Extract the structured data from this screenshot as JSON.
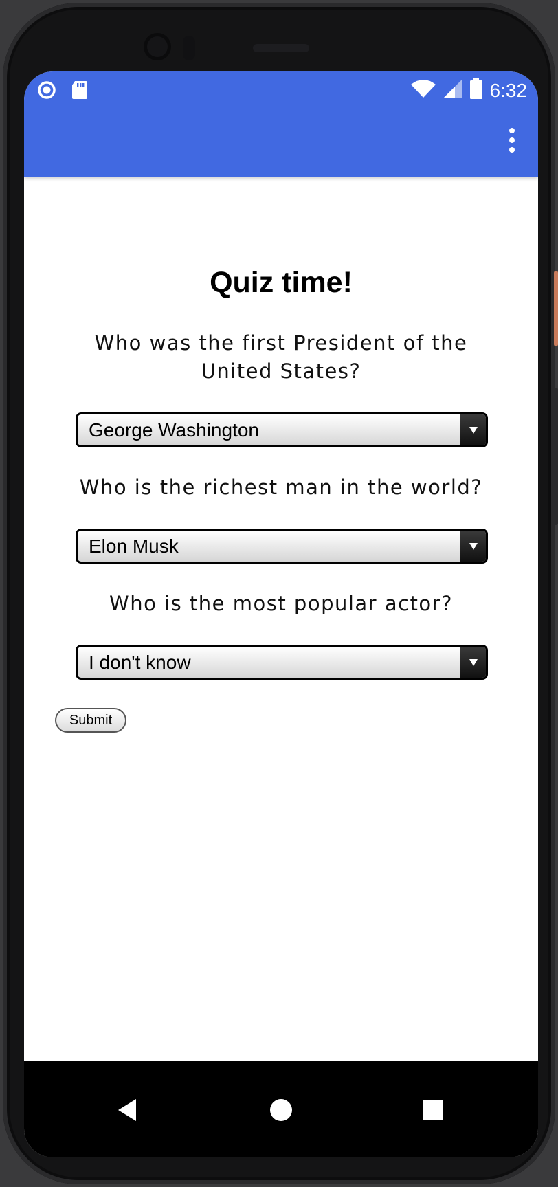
{
  "status_bar": {
    "time": "6:32"
  },
  "quiz": {
    "title": "Quiz time!",
    "questions": [
      {
        "text": "Who was the first President of the United States?",
        "selected": "George Washington"
      },
      {
        "text": "Who is the richest man in the world?",
        "selected": "Elon Musk"
      },
      {
        "text": "Who is the most popular actor?",
        "selected": "I don't know"
      }
    ],
    "submit_label": "Submit"
  },
  "colors": {
    "app_bar": "#4169e1",
    "background": "#ffffff",
    "nav_bar": "#000000"
  },
  "icons": {
    "status_left": [
      "circle-notification-icon",
      "sd-card-icon"
    ],
    "status_right": [
      "wifi-icon",
      "signal-icon",
      "battery-icon"
    ],
    "app_bar": [
      "more-vert-icon"
    ],
    "nav_bar": [
      "back-icon",
      "home-icon",
      "recents-icon"
    ]
  }
}
